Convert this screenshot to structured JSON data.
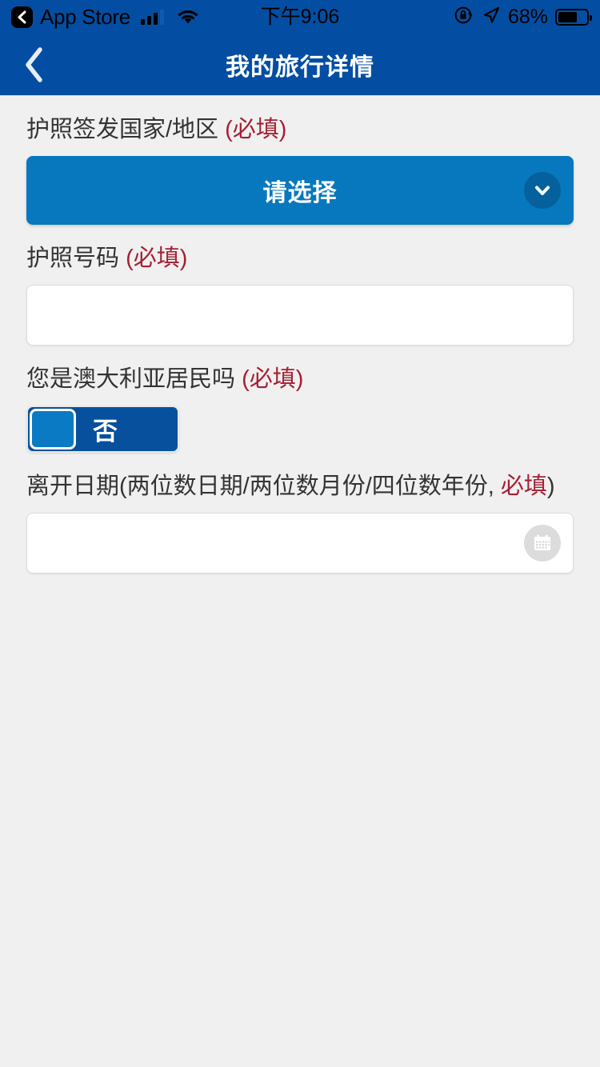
{
  "status_bar": {
    "back_chip_icon": "chevron-left-icon",
    "carrier_label": "App Store",
    "signal_icon": "cellular-signal-icon",
    "wifi_icon": "wifi-icon",
    "time": "下午9:06",
    "rotation_lock_icon": "rotation-lock-icon",
    "location_icon": "location-arrow-icon",
    "battery_percent": "68%",
    "battery_icon": "battery-icon"
  },
  "nav_bar": {
    "back_icon": "chevron-left-icon",
    "title": "我的旅行详情"
  },
  "colors": {
    "brand_blue": "#034ea2",
    "accent_blue": "#0878be",
    "toggle_track": "#07509e",
    "toggle_knob": "#0a7ac4",
    "required_red": "#a52034",
    "page_background": "#f0f0f0",
    "label_text": "#333333"
  },
  "form": {
    "fields": [
      {
        "id": "passport-country",
        "label_main": "护照签发国家/地区 ",
        "label_required": "(必填)",
        "control": "select",
        "select_value": "请选择",
        "caret_icon": "chevron-down-icon"
      },
      {
        "id": "passport-number",
        "label_main": "护照号码 ",
        "label_required": "(必填)",
        "control": "text",
        "value": "",
        "placeholder": ""
      },
      {
        "id": "australian-resident",
        "label_main": "您是澳大利亚居民吗 ",
        "label_required": "(必填)",
        "control": "toggle",
        "toggle_value": "否",
        "toggle_state": "off"
      },
      {
        "id": "departure-date",
        "label_main": "离开日期(两位数日期/两位数月份/四位数年份, ",
        "label_required": "必填",
        "label_tail": ")",
        "control": "date",
        "value": "",
        "placeholder": "",
        "calendar_icon": "calendar-icon"
      }
    ]
  }
}
